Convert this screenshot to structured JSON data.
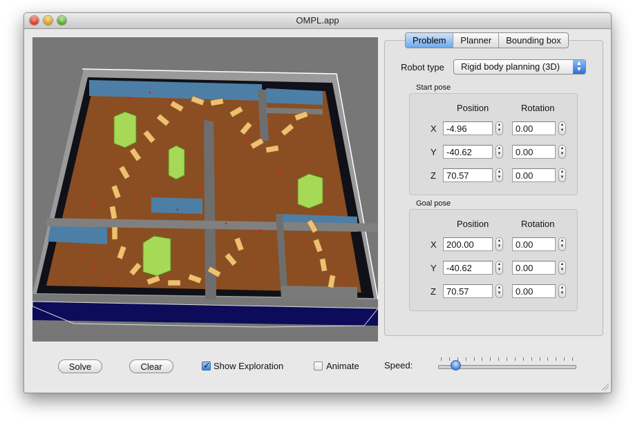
{
  "window": {
    "title": "OMPL.app"
  },
  "tabs": [
    {
      "label": "Problem",
      "active": true
    },
    {
      "label": "Planner",
      "active": false
    },
    {
      "label": "Bounding box",
      "active": false
    }
  ],
  "robot_type": {
    "label": "Robot type",
    "value": "Rigid body planning (3D)"
  },
  "start_pose": {
    "title": "Start pose",
    "headers": {
      "position": "Position",
      "rotation": "Rotation"
    },
    "rows": [
      {
        "axis": "X",
        "position": "-4.96",
        "rotation": "0.00"
      },
      {
        "axis": "Y",
        "position": "-40.62",
        "rotation": "0.00"
      },
      {
        "axis": "Z",
        "position": "70.57",
        "rotation": "0.00"
      }
    ]
  },
  "goal_pose": {
    "title": "Goal pose",
    "headers": {
      "position": "Position",
      "rotation": "Rotation"
    },
    "rows": [
      {
        "axis": "X",
        "position": "200.00",
        "rotation": "0.00"
      },
      {
        "axis": "Y",
        "position": "-40.62",
        "rotation": "0.00"
      },
      {
        "axis": "Z",
        "position": "70.57",
        "rotation": "0.00"
      }
    ]
  },
  "controls": {
    "solve": "Solve",
    "clear": "Clear",
    "show_exploration": {
      "label": "Show Exploration",
      "checked": true
    },
    "animate": {
      "label": "Animate",
      "checked": false
    },
    "speed_label": "Speed:",
    "speed_value": 0.1
  },
  "colors": {
    "floor": "#8a4e22",
    "walls_dark": "#101018",
    "wall_top": "#4d7fa6",
    "obstacle": "#a6d955",
    "robot": "#f0c070",
    "samples": "#e01818",
    "base": "#0c0c5a",
    "accent": "#3d7fd9"
  }
}
